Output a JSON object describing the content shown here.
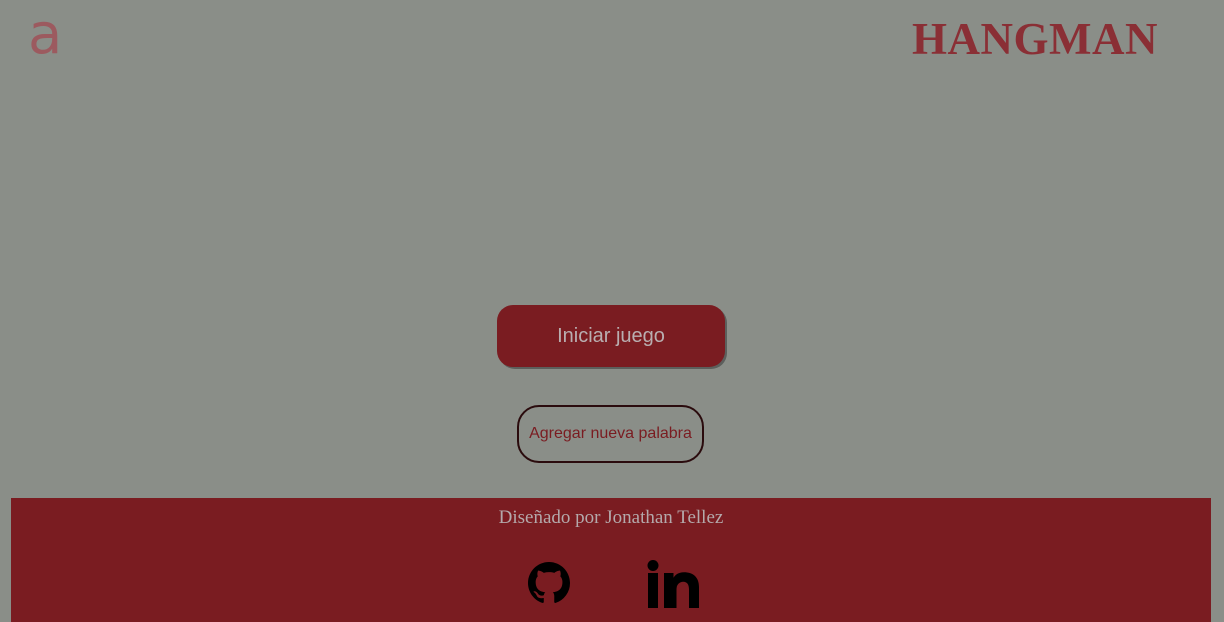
{
  "header": {
    "logo_glyph": "a",
    "title": "HANGMAN"
  },
  "main": {
    "start_label": "Iniciar juego",
    "add_word_label": "Agregar nueva palabra"
  },
  "footer": {
    "credit": "Diseñado por Jonathan Tellez",
    "links": [
      {
        "icon": "github-icon"
      },
      {
        "icon": "linkedin-icon"
      }
    ]
  },
  "colors": {
    "background": "#8a8e88",
    "accent": "#7a1c21",
    "title": "#8a2f35"
  }
}
